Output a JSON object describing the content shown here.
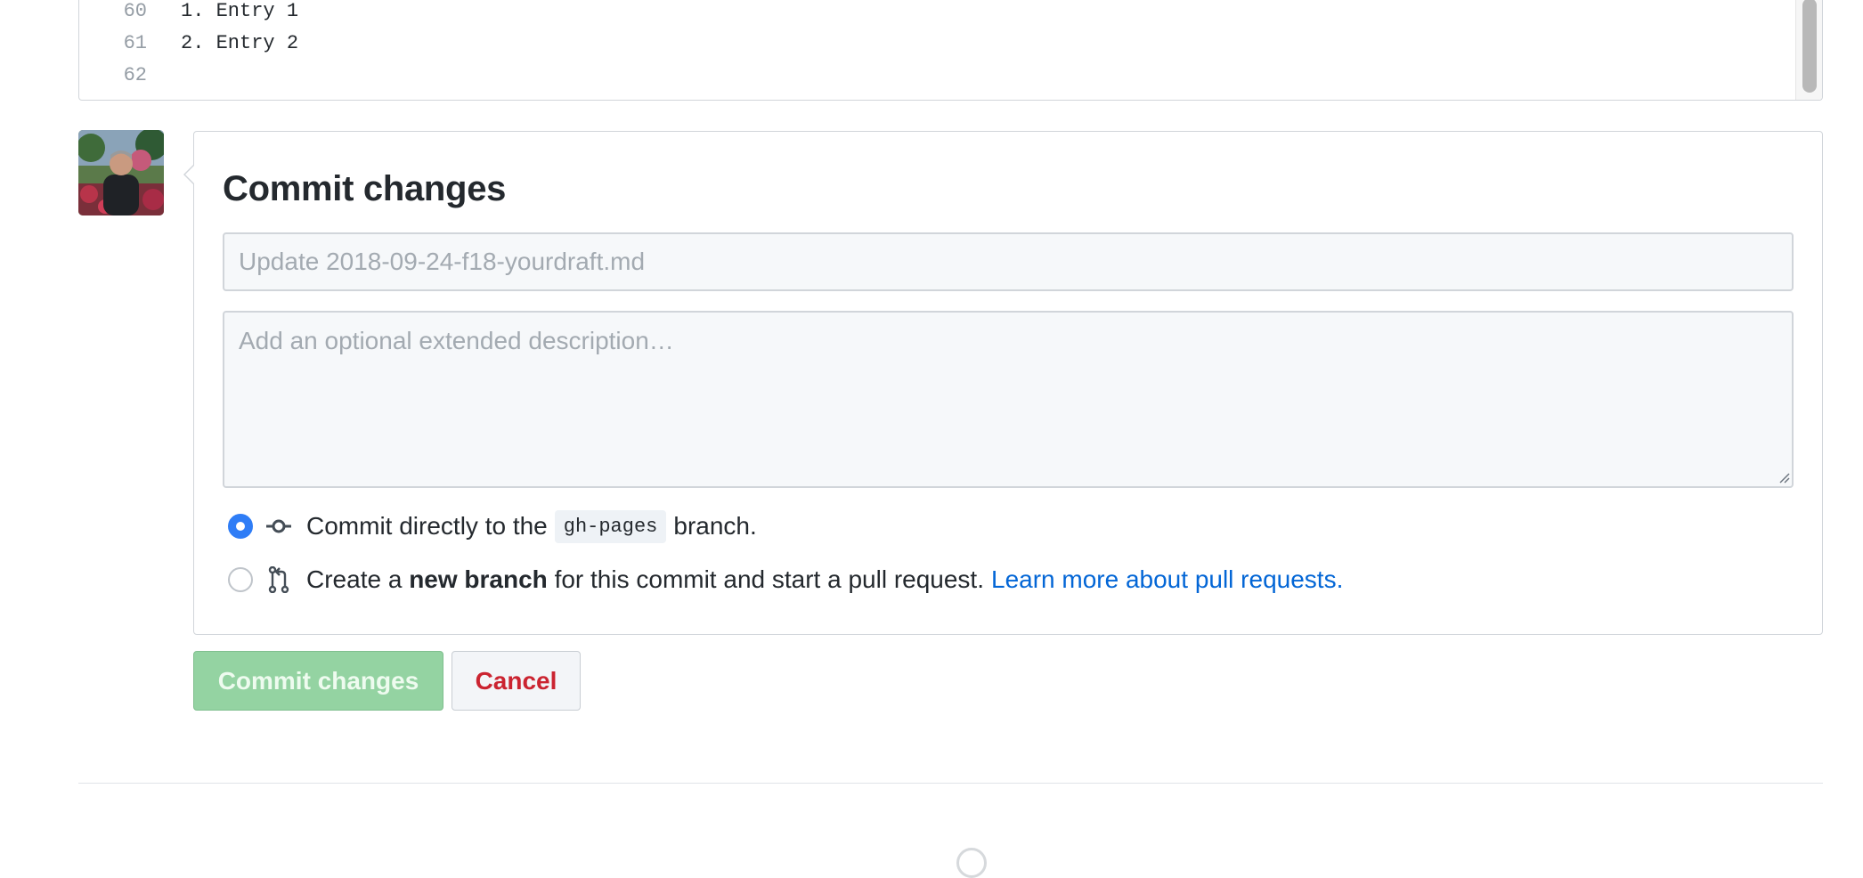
{
  "editor": {
    "lines": [
      {
        "num": "60",
        "code": "1. Entry 1"
      },
      {
        "num": "61",
        "code": "2. Entry 2"
      },
      {
        "num": "62",
        "code": ""
      }
    ]
  },
  "commit": {
    "title": "Commit changes",
    "summary_placeholder": "Update 2018-09-24-f18-yourdraft.md",
    "description_placeholder": "Add an optional extended description…",
    "option_direct": {
      "prefix": "Commit directly to the",
      "branch": "gh-pages",
      "suffix": "branch."
    },
    "option_new": {
      "prefix": "Create a",
      "bold": "new branch",
      "suffix": "for this commit and start a pull request.",
      "link": "Learn more about pull requests."
    },
    "commit_button": "Commit changes",
    "cancel_button": "Cancel"
  },
  "icons": {
    "commit": "git-commit-icon",
    "pull_request": "git-pull-request-icon"
  },
  "colors": {
    "primary": "#2f7df6",
    "commit_button": "#94d3a2",
    "cancel_text": "#cb2431",
    "link": "#0366d6"
  }
}
